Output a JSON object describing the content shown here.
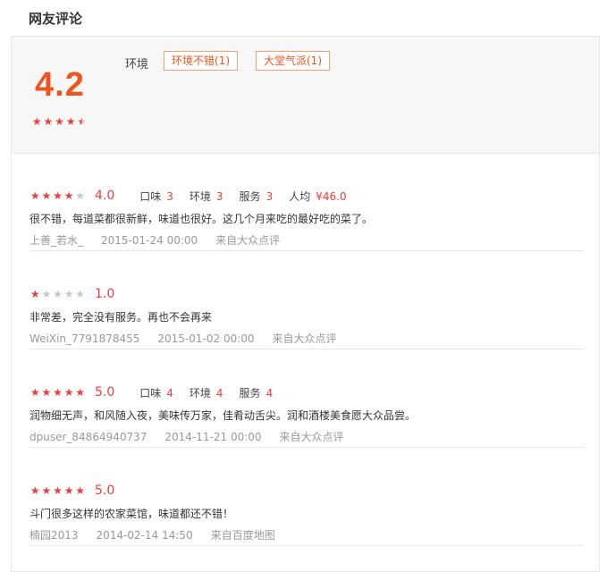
{
  "section_title": "网友评论",
  "summary": {
    "score": "4.2",
    "stars": 4.5,
    "tag_label": "环境",
    "tags": [
      "环境不错(1)",
      "大堂气派(1)"
    ]
  },
  "reviews": [
    {
      "stars": 4,
      "score": "4.0",
      "sub_scores": [
        {
          "label": "口味",
          "value": "3"
        },
        {
          "label": "环境",
          "value": "3"
        },
        {
          "label": "服务",
          "value": "3"
        },
        {
          "label": "人均",
          "value": "¥46.0"
        }
      ],
      "text": "很不错，每道菜都很新鲜，味道也很好。这几个月来吃的最好吃的菜了。",
      "user": "上善_若水_",
      "time": "2015-01-24 00:00",
      "source": "来自大众点评"
    },
    {
      "stars": 1,
      "score": "1.0",
      "sub_scores": [],
      "text": "非常差，完全没有服务。再也不会再来",
      "user": "WeiXin_7791878455",
      "time": "2015-01-02 00:00",
      "source": "来自大众点评"
    },
    {
      "stars": 5,
      "score": "5.0",
      "sub_scores": [
        {
          "label": "口味",
          "value": "4"
        },
        {
          "label": "环境",
          "value": "4"
        },
        {
          "label": "服务",
          "value": "4"
        }
      ],
      "text": "润物细无声，和风随入夜，美味传万家，佳肴动舌尖。润和酒楼美食愿大众品尝。",
      "user": "dpuser_84864940737",
      "time": "2014-11-21 00:00",
      "source": "来自大众点评"
    },
    {
      "stars": 5,
      "score": "5.0",
      "sub_scores": [],
      "text": "斗门很多这样的农家菜馆，味道都还不错！",
      "user": "楠园2013",
      "time": "2014-02-14 14:50",
      "source": "来自百度地图"
    }
  ]
}
